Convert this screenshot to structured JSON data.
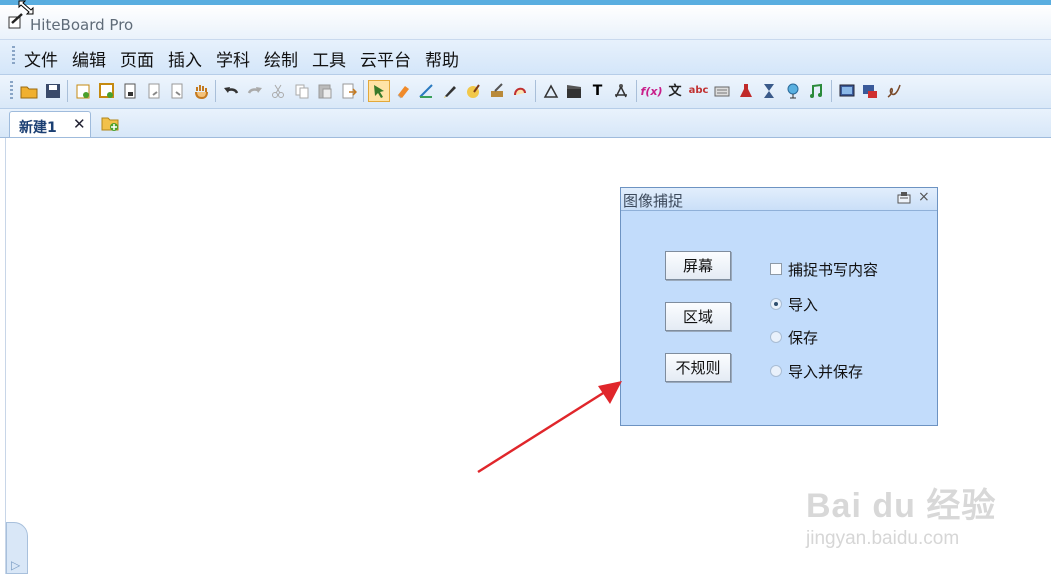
{
  "app": {
    "title": "HiteBoard Pro"
  },
  "menu": {
    "items": [
      "文件",
      "编辑",
      "页面",
      "插入",
      "学科",
      "绘制",
      "工具",
      "云平台",
      "帮助"
    ]
  },
  "toolbar": {
    "icons": [
      "open-folder-icon",
      "save-icon",
      "new-page-icon",
      "add-page-icon",
      "page-icon",
      "page-prev-icon",
      "page-next-icon",
      "hand-icon",
      "undo-icon",
      "redo-icon",
      "cut-icon",
      "copy-icon",
      "paste-icon",
      "page-export-icon",
      "select-icon",
      "eraser-icon",
      "ruler-pen-icon",
      "pen-icon",
      "brush-icon",
      "highlighter-icon",
      "shape-pen-icon",
      "triangle-icon",
      "clapper-icon",
      "text-icon",
      "compass-icon",
      "formula-icon",
      "chinese-text-icon",
      "abc-icon",
      "keyboard-icon",
      "flask-icon",
      "hourglass-icon",
      "globe-icon",
      "music-icon",
      "screenshot-icon",
      "record-icon",
      "signature-icon"
    ],
    "glyphs": {
      "text": "T",
      "formula": "f(x)",
      "chinese": "文",
      "abc": "abc"
    },
    "active": "select-icon"
  },
  "tabs": [
    {
      "label": "新建1",
      "close": "✕"
    }
  ],
  "capture_panel": {
    "title": "图像捕捉",
    "close": "×",
    "buttons": {
      "screen": "屏幕",
      "region": "区域",
      "irregular": "不规则"
    },
    "checkbox": {
      "label": "捕捉书写内容",
      "checked": false
    },
    "radios": [
      {
        "label": "导入",
        "selected": true
      },
      {
        "label": "保存",
        "selected": false
      },
      {
        "label": "导入并保存",
        "selected": false
      }
    ]
  },
  "watermark": {
    "logo": "Bai du 经验",
    "url": "jingyan.baidu.com"
  },
  "colors": {
    "accent": "#c2dcfb",
    "arrow": "#e0262b",
    "active_tool": "#ffe3a6"
  }
}
